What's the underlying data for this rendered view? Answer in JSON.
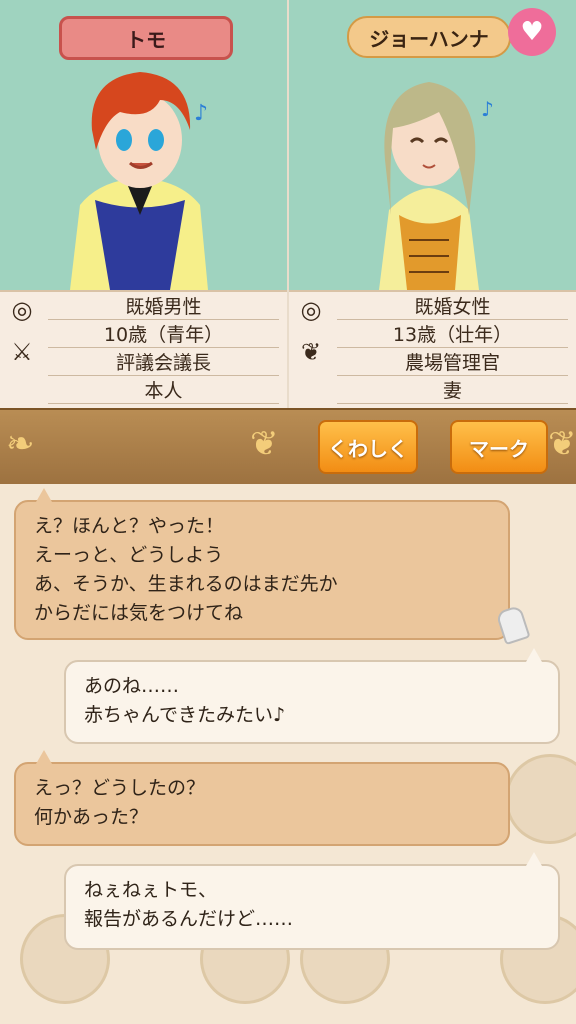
{
  "characters": {
    "left": {
      "name": "トモ",
      "rows": [
        "既婚男性",
        "10歳（青年）",
        "評議会議長",
        "本人"
      ]
    },
    "right": {
      "name": "ジョーハンナ",
      "rows": [
        "既婚女性",
        "13歳（壮年）",
        "農場管理官",
        "妻"
      ]
    }
  },
  "buttons": {
    "details": "くわしく",
    "mark": "マーク"
  },
  "chat": [
    {
      "side": "left",
      "lines": [
        "え？ほんと？やった！",
        "えーっと、どうしよう",
        "あ、そうか、生まれるのはまだ先か",
        "からだには気をつけてね"
      ]
    },
    {
      "side": "right",
      "lines": [
        "あのね……",
        "赤ちゃんできたみたい♪"
      ]
    },
    {
      "side": "left",
      "lines": [
        "えっ？どうしたの？",
        "何かあった？"
      ]
    },
    {
      "side": "right",
      "lines": [
        "ねぇねぇトモ、",
        "報告があるんだけど……"
      ]
    }
  ],
  "icons": {
    "ring": "ring-icon",
    "swords": "crossed-swords-icon",
    "wheat": "wheat-icon",
    "heart": "heart-icon"
  },
  "colors": {
    "accent_orange": "#f28d14",
    "panel_green": "#9fd3bf",
    "heart_pink": "#ef6d9a"
  }
}
